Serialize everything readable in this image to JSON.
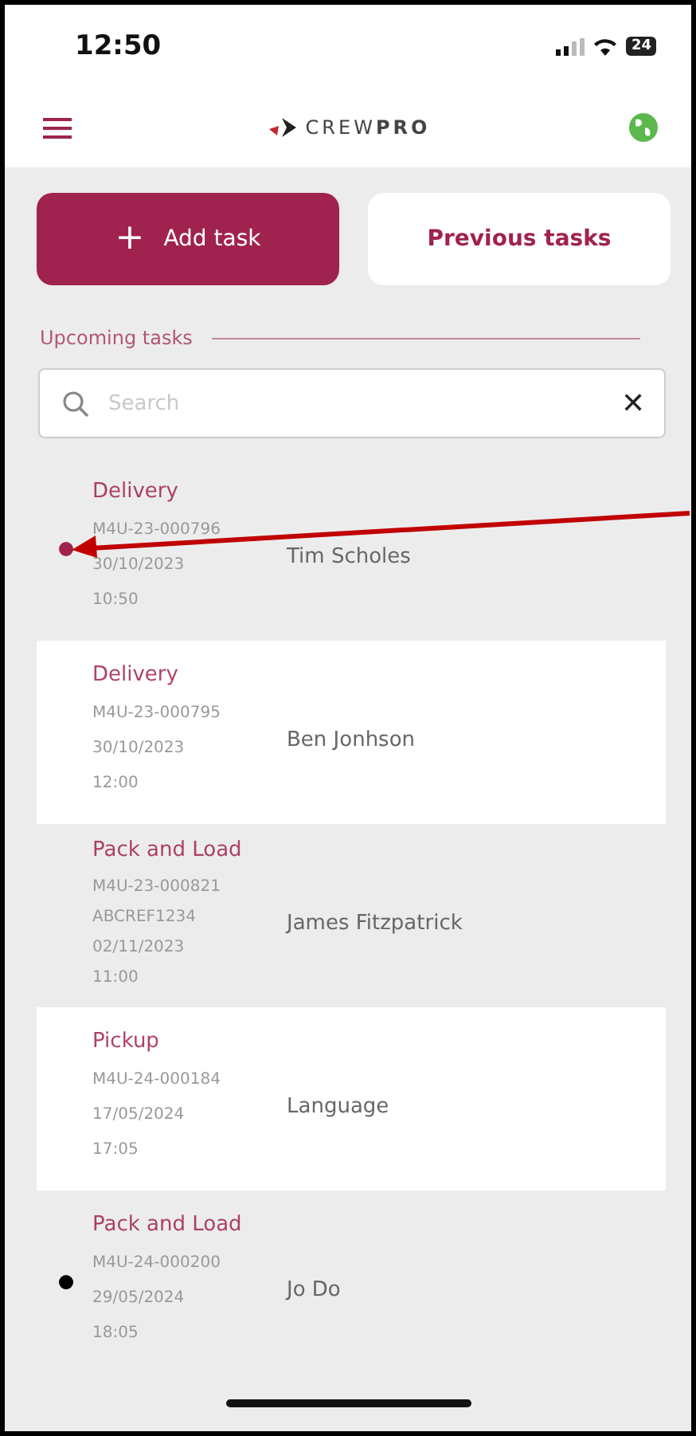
{
  "status_bar": {
    "time": "12:50",
    "battery": "24"
  },
  "header": {
    "logo_text": "CREW",
    "logo_bold": "PRO"
  },
  "actions": [
    {
      "label": "Add task",
      "icon": "+",
      "kind": "primary"
    },
    {
      "label": "Previous tasks",
      "kind": "secondary"
    }
  ],
  "section_title": "Upcoming tasks",
  "search": {
    "placeholder": "Search",
    "clear": "✕"
  },
  "tasks": [
    {
      "type": "Delivery",
      "lines": [
        "M4U-23-000796",
        "30/10/2023",
        "10:50"
      ],
      "name": "Tim Scholes",
      "color": "#a0224f",
      "shaded": true
    },
    {
      "type": "Delivery",
      "lines": [
        "M4U-23-000795",
        "30/10/2023",
        "12:00"
      ],
      "name": "Ben Jonhson",
      "shaded": false
    },
    {
      "type": "Pack and Load",
      "lines": [
        "M4U-23-000821",
        "ABCREF1234",
        "02/11/2023",
        "11:00"
      ],
      "name": "James Fitzpatrick",
      "shaded": true
    },
    {
      "type": "Pickup",
      "lines": [
        "M4U-24-000184",
        "17/05/2024",
        "17:05"
      ],
      "name": "Language",
      "shaded": false
    },
    {
      "type": "Pack and Load",
      "lines": [
        "M4U-24-000200",
        "29/05/2024",
        "18:05"
      ],
      "name": "Jo Do",
      "color": "#000000",
      "shaded": true
    }
  ]
}
